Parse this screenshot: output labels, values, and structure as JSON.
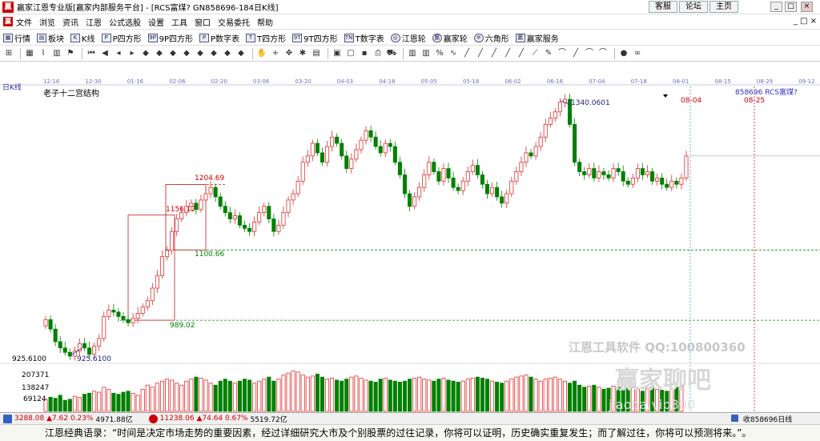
{
  "window": {
    "logo_text": "赢",
    "title": "赢家江恩专业版[赢家内部服务平台] - [RCS富煤? GN858696-184日K线]",
    "links": [
      "客服",
      "论坛",
      "主页"
    ],
    "controls": [
      "_",
      "□",
      "×"
    ]
  },
  "menu": {
    "logo_text": "赢",
    "items": [
      "文件",
      "浏览",
      "资讯",
      "江恩",
      "公式选股",
      "设置",
      "工具",
      "窗口",
      "交易委托",
      "帮助"
    ],
    "right_controls": "_ □ ×"
  },
  "toolbar1": {
    "items": [
      {
        "icon": "grid-icon",
        "glyph": "▦",
        "label": "行情"
      },
      {
        "icon": "blocks-icon",
        "glyph": "▤",
        "label": "板块"
      },
      {
        "icon": "kline-icon",
        "glyph": "K",
        "label": "K线"
      },
      {
        "icon": "p-square-icon",
        "glyph": "P",
        "label": "P四方形"
      },
      {
        "icon": "9p-square-icon",
        "glyph": "9P",
        "label": "9P四方形"
      },
      {
        "icon": "p-number-icon",
        "glyph": "P",
        "label": "P数字表"
      },
      {
        "icon": "t-square-icon",
        "glyph": "T",
        "label": "T四方形"
      },
      {
        "icon": "9t-square-icon",
        "glyph": "9T",
        "label": "9T四方形"
      },
      {
        "icon": "t-number-icon",
        "glyph": "TN",
        "label": "T数字表"
      },
      {
        "icon": "gann-wheel-icon",
        "glyph": "◎",
        "label": "江恩轮",
        "round": true
      },
      {
        "icon": "winner-wheel-icon",
        "glyph": "赢",
        "label": "赢家轮",
        "round": true
      },
      {
        "icon": "hexagon-icon",
        "glyph": "✡",
        "label": "六角形",
        "round": true
      },
      {
        "icon": "service-icon",
        "glyph": "赢",
        "label": "赢家服务"
      }
    ]
  },
  "toolbar2": {
    "icons": [
      "cursor-icon",
      "sep",
      "grid-icon",
      "chart-icon",
      "bars-icon",
      "flag-icon",
      "sep",
      "first-icon",
      "prev-icon",
      "back-icon",
      "forward-icon",
      "diamond-icon",
      "diamond-icon",
      "diamond-icon",
      "diamond-icon",
      "diamond-icon",
      "diamond-icon",
      "diamond-icon",
      "diamond-icon",
      "sep",
      "hand-icon",
      "cross-icon",
      "move-icon",
      "star-icon",
      "table-icon",
      "sep",
      "calendar-icon",
      "doc-icon",
      "save-icon",
      "print-icon",
      "car-icon",
      "sep",
      "bars-icon",
      "bars-icon",
      "percent-icon",
      "wave-icon",
      "line-icon",
      "line-icon",
      "line-icon",
      "line-icon",
      "line-icon",
      "diag-icon",
      "pen-icon",
      "curve-icon",
      "line-icon",
      "curve-icon",
      "curve-icon",
      "sep",
      "ball-icon",
      "infinity-icon"
    ],
    "glyphs": {
      "cursor-icon": "⊞",
      "grid-icon": "▦",
      "chart-icon": "⌇",
      "bars-icon": "▥",
      "flag-icon": "⚑",
      "first-icon": "⏮",
      "prev-icon": "◀",
      "back-icon": "◂",
      "forward-icon": "▸",
      "diamond-icon": "◆",
      "hand-icon": "✋",
      "cross-icon": "+",
      "move-icon": "✥",
      "star-icon": "✱",
      "table-icon": "▤",
      "calendar-icon": "▣",
      "doc-icon": "▢",
      "save-icon": "▪",
      "print-icon": "⎙",
      "car-icon": "⛟",
      "percent-icon": "%",
      "wave-icon": "∿",
      "line-icon": "╱",
      "diag-icon": "⟋",
      "pen-icon": "✎",
      "curve-icon": "⌒",
      "ball-icon": "●",
      "infinity-icon": "∞"
    }
  },
  "chart": {
    "period_label": "日K线",
    "date_axis": [
      "12-16",
      "12-30",
      "01-16",
      "02-06",
      "02-20",
      "03-06",
      "03-20",
      "04-03",
      "04-18",
      "05-05",
      "05-18",
      "06-02",
      "06-16",
      "07-04",
      "07-18",
      "08-01",
      "08-15",
      "08-29",
      "09-12"
    ],
    "indicator_title": "老子十二宫结构",
    "symbol_label": "858696 RCS富煤?",
    "marker_dates": [
      "08-04",
      "08-25"
    ],
    "annotations": {
      "high": "1340.0601",
      "low": "925.6100",
      "low_left": "925.6100",
      "box_top": "1204.69",
      "box_mid": "1156.12",
      "support_1": "1100.66",
      "support_2": "989.02"
    },
    "volume_axis": [
      "207371",
      "138247",
      "69124"
    ],
    "watermark_1": "江恩工具软件 QQ:100800360",
    "watermark_2": "赢家聊吧",
    "watermark_3": "jiaoba.vip300",
    "colors": {
      "up": "#e03030",
      "down": "#008000",
      "axis": "#6c6cc0",
      "guide": "#cc2222"
    }
  },
  "chart_data": {
    "type": "candlestick",
    "title": "老子十二宫结构",
    "x_axis_labels": [
      "12-16",
      "12-30",
      "01-16",
      "02-06",
      "02-20",
      "03-06",
      "03-20",
      "04-03",
      "04-18",
      "05-05",
      "05-18",
      "06-02",
      "06-16",
      "07-04",
      "07-18",
      "08-01",
      "08-15",
      "08-29",
      "09-12"
    ],
    "price_range": [
      925.61,
      1340.06
    ],
    "levels": [
      1340.0601,
      1204.69,
      1156.12,
      1100.66,
      989.02,
      925.61
    ],
    "volume_ticks": [
      207371,
      138247,
      69124
    ],
    "series": [
      {
        "name": "candles",
        "closes": [
          990,
          975,
          955,
          945,
          938,
          932,
          940,
          952,
          945,
          935,
          948,
          960,
          995,
          1005,
          1002,
          995,
          990,
          985,
          992,
          1000,
          1010,
          1020,
          1040,
          1060,
          1090,
          1100,
          1130,
          1150,
          1160,
          1170,
          1175,
          1165,
          1180,
          1190,
          1200,
          1185,
          1170,
          1160,
          1150,
          1155,
          1140,
          1135,
          1130,
          1145,
          1160,
          1170,
          1150,
          1130,
          1140,
          1160,
          1180,
          1190,
          1210,
          1240,
          1250,
          1270,
          1255,
          1240,
          1265,
          1280,
          1270,
          1250,
          1230,
          1245,
          1260,
          1275,
          1290,
          1280,
          1265,
          1255,
          1270,
          1265,
          1240,
          1220,
          1190,
          1170,
          1185,
          1200,
          1220,
          1240,
          1225,
          1210,
          1230,
          1215,
          1200,
          1195,
          1210,
          1225,
          1235,
          1220,
          1205,
          1190,
          1200,
          1185,
          1175,
          1190,
          1210,
          1225,
          1240,
          1255,
          1250,
          1265,
          1280,
          1300,
          1310,
          1320,
          1335,
          1340,
          1300,
          1240,
          1225,
          1220,
          1230,
          1215,
          1225,
          1220,
          1215,
          1230,
          1225,
          1210,
          1205,
          1215,
          1230,
          1220,
          1225,
          1210,
          1215,
          1205,
          1200,
          1210,
          1205,
          1215,
          1250
        ]
      },
      {
        "name": "volume",
        "values": [
          60000,
          70000,
          65000,
          80000,
          55000,
          60000,
          75000,
          70000,
          85000,
          90000,
          100000,
          95000,
          120000,
          110000,
          90000,
          85000,
          95000,
          100000,
          90000,
          80000,
          110000,
          130000,
          120000,
          140000,
          150000,
          160000,
          155000,
          140000,
          130000,
          150000,
          160000,
          170000,
          165000,
          155000,
          140000,
          130000,
          150000,
          160000,
          150000,
          140000,
          150000,
          160000,
          155000,
          140000,
          150000,
          160000,
          170000,
          150000,
          160000,
          180000,
          190000,
          200000,
          195000,
          180000,
          170000,
          175000,
          185000,
          170000,
          160000,
          165000,
          155000,
          150000,
          160000,
          170000,
          175000,
          165000,
          155000,
          150000,
          145000,
          160000,
          165000,
          155000,
          150000,
          145000,
          150000,
          160000,
          165000,
          170000,
          160000,
          155000,
          150000,
          160000,
          165000,
          155000,
          150000,
          145000,
          150000,
          160000,
          165000,
          170000,
          165000,
          160000,
          150000,
          145000,
          140000,
          150000,
          160000,
          170000,
          175000,
          180000,
          170000,
          160000,
          150000,
          160000,
          165000,
          170000,
          160000,
          150000,
          140000,
          150000,
          130000,
          120000,
          125000,
          130000,
          120000,
          110000,
          115000,
          125000,
          120000,
          110000,
          115000,
          120000,
          110000,
          100000,
          115000,
          120000,
          110000,
          105000,
          100000,
          110000,
          120000,
          125000
        ]
      }
    ]
  },
  "status": {
    "index1": {
      "value": "3288.08",
      "change": "▲7.62",
      "pct": "0.23%",
      "amount": "4971.88亿"
    },
    "index2": {
      "value": "11238.06",
      "change": "▲74.64",
      "pct": "0.67%",
      "amount": "5519.72亿"
    },
    "right_label": "收858696日线"
  },
  "quote": {
    "text": "江恩经典语录：“时间是决定市场走势的重要因素，经过详细研究大市及个别股票的过往记录，你将可以证明，历史确实重复发生；而了解过往，你将可以预测将来。”。"
  }
}
